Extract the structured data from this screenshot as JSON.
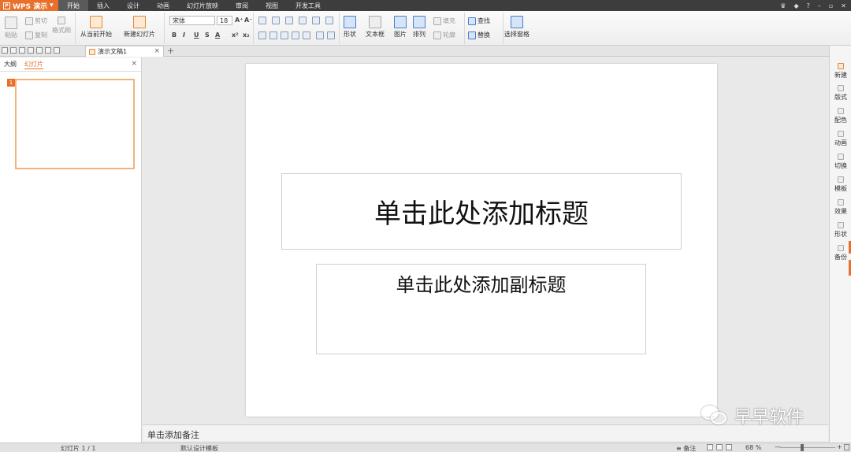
{
  "app": {
    "name": "WPS 演示",
    "menu_tabs": [
      "开始",
      "插入",
      "设计",
      "动画",
      "幻灯片放映",
      "审阅",
      "视图",
      "开发工具"
    ],
    "active_tab_index": 0,
    "top_right": [
      "?"
    ]
  },
  "ribbon": {
    "paste": "粘贴",
    "cut": "剪切",
    "copy": "复制",
    "format_painter": "格式刷",
    "from_current": "从当前开始",
    "new_slide": "新建幻灯片",
    "font_name": "宋体",
    "font_size": "18",
    "grow_font": "A⁺",
    "shrink_font": "A⁻",
    "bold": "B",
    "italic": "I",
    "underline": "U",
    "strike": "S",
    "font_color": "A",
    "superscript": "x²",
    "subscript": "x₂",
    "shape": "形状",
    "textbox": "文本框",
    "picture": "图片",
    "arrange": "排列",
    "fill": "填充",
    "outline": "轮廓",
    "find": "查找",
    "replace": "替换",
    "select_pane": "选择窗格"
  },
  "doc_tab": {
    "title": "演示文稿1",
    "close": "×",
    "new": "+"
  },
  "left_pane": {
    "tab_outline": "大纲",
    "tab_slides": "幻灯片",
    "close": "×",
    "slide_number": "1"
  },
  "slide": {
    "title_placeholder": "单击此处添加标题",
    "subtitle_placeholder": "单击此处添加副标题"
  },
  "notes_placeholder": "单击添加备注",
  "right_sidebar": [
    "新建",
    "版式",
    "配色",
    "动画",
    "切换",
    "模板",
    "效果",
    "形状",
    "备份"
  ],
  "status_bar": {
    "slide_indicator": "幻灯片 1 / 1",
    "template": "默认设计模板",
    "notes": "备注",
    "zoom": "68 %",
    "zoom_minus": "—",
    "zoom_plus": "+"
  },
  "watermark": "早早软件"
}
